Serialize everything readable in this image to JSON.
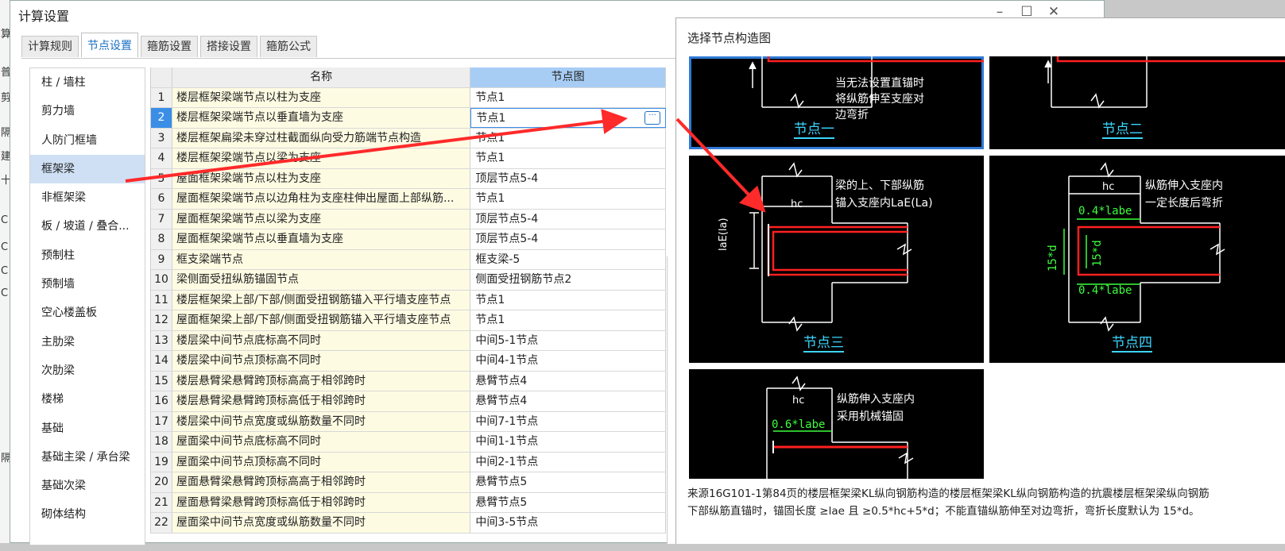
{
  "window": {
    "title": "计算设置"
  },
  "background_fragments": [
    "算",
    "普",
    "剪",
    "隔",
    "建",
    "十",
    "C",
    "C",
    "C",
    "C",
    "隔"
  ],
  "tabs": [
    "计算规则",
    "节点设置",
    "箍筋设置",
    "搭接设置",
    "箍筋公式"
  ],
  "categories": [
    "柱 / 墙柱",
    "剪力墙",
    "人防门框墙",
    "框架梁",
    "非框架梁",
    "板 / 坡道 / 叠合...",
    "预制柱",
    "预制墙",
    "空心楼盖板",
    "主肋梁",
    "次肋梁",
    "楼梯",
    "基础",
    "基础主梁 / 承台梁",
    "基础次梁",
    "砌体结构"
  ],
  "table": {
    "headers": [
      "名称",
      "节点图"
    ],
    "rows": [
      {
        "no": "1",
        "name": "楼层框架梁端节点以柱为支座",
        "node": "节点1"
      },
      {
        "no": "2",
        "name": "楼层框架梁端节点以垂直墙为支座",
        "node": "节点1",
        "more": "···"
      },
      {
        "no": "3",
        "name": "楼层框架扁梁未穿过柱截面纵向受力筋端节点构造",
        "node": "节点1"
      },
      {
        "no": "4",
        "name": "楼层框架梁端节点以梁为支座",
        "node": "节点1"
      },
      {
        "no": "5",
        "name": "屋面框架梁端节点以柱为支座",
        "node": "顶层节点5-4"
      },
      {
        "no": "6",
        "name": "屋面框架梁端节点以边角柱为支座柱伸出屋面上部纵筋...",
        "node": "节点1"
      },
      {
        "no": "7",
        "name": "屋面框架梁端节点以梁为支座",
        "node": "顶层节点5-4"
      },
      {
        "no": "8",
        "name": "屋面框架梁端节点以垂直墙为支座",
        "node": "顶层节点5-4"
      },
      {
        "no": "9",
        "name": "框支梁端节点",
        "node": "框支梁-5"
      },
      {
        "no": "10",
        "name": "梁侧面受扭纵筋锚固节点",
        "node": "侧面受扭钢筋节点2"
      },
      {
        "no": "11",
        "name": "楼层框架梁上部/下部/侧面受扭钢筋锚入平行墙支座节点",
        "node": "节点1"
      },
      {
        "no": "12",
        "name": "屋面框架梁上部/下部/侧面受扭钢筋锚入平行墙支座节点",
        "node": "节点1"
      },
      {
        "no": "13",
        "name": "楼层梁中间节点底标高不同时",
        "node": "中间5-1节点"
      },
      {
        "no": "14",
        "name": "楼层梁中间节点顶标高不同时",
        "node": "中间4-1节点"
      },
      {
        "no": "15",
        "name": "楼层悬臂梁悬臂跨顶标高高于相邻跨时",
        "node": "悬臂节点4"
      },
      {
        "no": "16",
        "name": "楼层悬臂梁悬臂跨顶标高低于相邻跨时",
        "node": "悬臂节点4"
      },
      {
        "no": "17",
        "name": "楼层梁中间节点宽度或纵筋数量不同时",
        "node": "中间7-1节点"
      },
      {
        "no": "18",
        "name": "屋面梁中间节点底标高不同时",
        "node": "中间1-1节点"
      },
      {
        "no": "19",
        "name": "屋面梁中间节点顶标高不同时",
        "node": "中间2-1节点"
      },
      {
        "no": "20",
        "name": "屋面悬臂梁悬臂跨顶标高高于相邻跨时",
        "node": "悬臂节点5"
      },
      {
        "no": "21",
        "name": "屋面悬臂梁悬臂跨顶标高低于相邻跨时",
        "node": "悬臂节点5"
      },
      {
        "no": "22",
        "name": "屋面梁中间节点宽度或纵筋数量不同时",
        "node": "中间3-5节点"
      }
    ]
  },
  "popup": {
    "title": "选择节点构造图",
    "nodes": [
      {
        "label": "节点一",
        "text": [
          "当无法设置直锚时",
          "将纵筋伸至支座对",
          "边弯折"
        ]
      },
      {
        "label": "节点二",
        "text": []
      },
      {
        "label": "节点三",
        "text": [
          "梁的上、下部纵筋",
          "锚入支座内LaE(La)"
        ],
        "dims": [
          "hc",
          "laE(la)"
        ]
      },
      {
        "label": "节点四",
        "text": [
          "纵筋伸入支座内",
          "一定长度后弯折"
        ],
        "dims": [
          "hc",
          "0.4*labe",
          "0.4*labe",
          "15*d",
          "15*d"
        ]
      },
      {
        "label": "",
        "text": [
          "纵筋伸入支座内",
          "采用机械锚固"
        ],
        "dims": [
          "hc",
          "0.6*labe"
        ]
      }
    ],
    "description": [
      "来源16G101-1第84页的楼层框架梁KL纵向钢筋构造的楼层框架梁KL纵向钢筋构造的抗震楼层框架梁纵向钢筋",
      "下部纵筋直锚时，锚固长度 ≥lae 且 ≥0.5*hc+5*d；不能直锚纵筋伸至对边弯折，弯折长度默认为 15*d。"
    ]
  },
  "colors": {
    "accent": "#1a6fc4",
    "selected_row": "#3a8ee6",
    "name_col": "#fdfbe2",
    "header_node": "#a8cdf5",
    "rebar": "#ff2020",
    "arrow": "#ff2a2a",
    "node_label": "#3cd6ff",
    "dim_text": "#3cff3c"
  }
}
